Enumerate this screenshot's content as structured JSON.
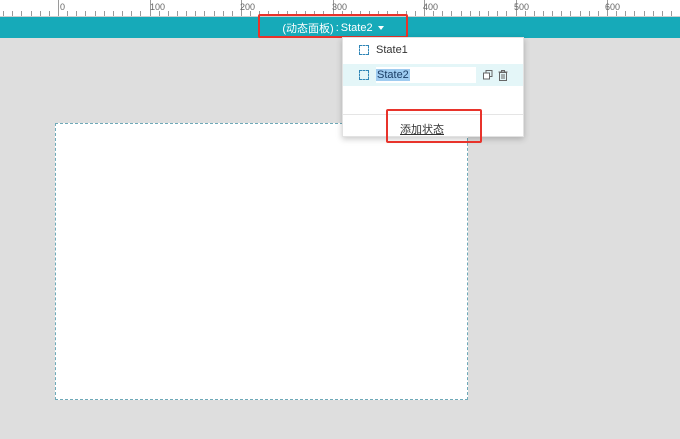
{
  "ruler": {
    "labels": [
      "0",
      "100",
      "200",
      "300",
      "400",
      "500",
      "600"
    ]
  },
  "state_bar": {
    "panel_label": "(动态面板)",
    "separator": ":",
    "current_state": "State2"
  },
  "dropdown": {
    "states": [
      {
        "label": "State1",
        "selected": false
      },
      {
        "label": "State2",
        "selected": true
      }
    ],
    "add_state_label": "添加状态"
  },
  "colors": {
    "state_bar": "#16aab9",
    "highlight_box": "#e8332b",
    "active_row": "#e4f6f8"
  }
}
